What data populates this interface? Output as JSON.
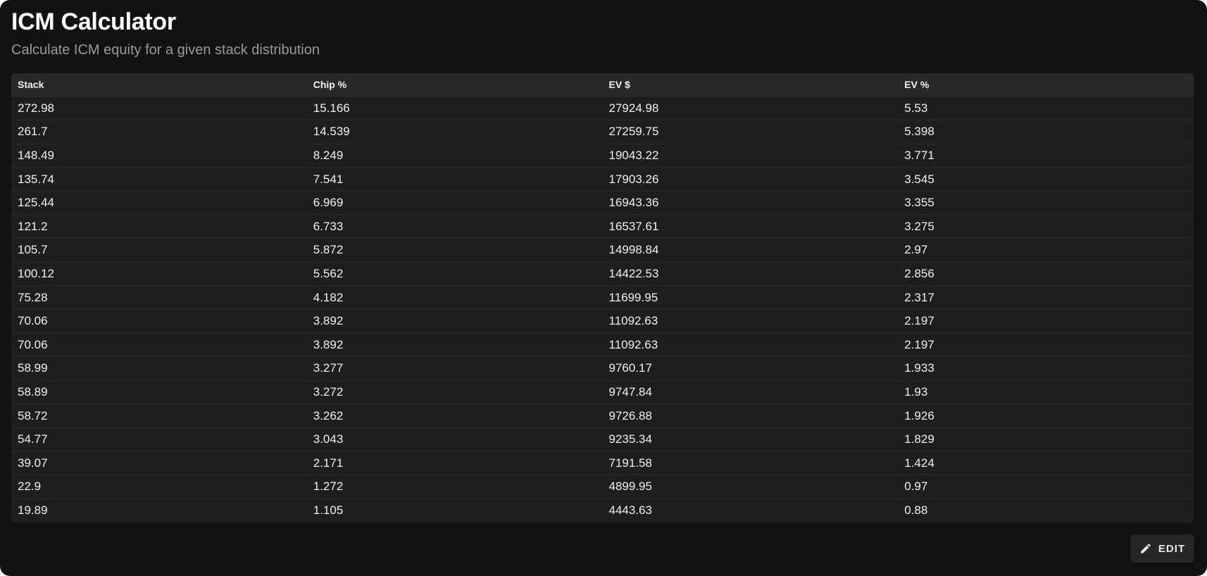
{
  "header": {
    "title": "ICM Calculator",
    "subtitle": "Calculate ICM equity for a given stack distribution"
  },
  "table": {
    "columns": [
      "Stack",
      "Chip %",
      "EV $",
      "EV %"
    ],
    "rows": [
      [
        "272.98",
        "15.166",
        "27924.98",
        "5.53"
      ],
      [
        "261.7",
        "14.539",
        "27259.75",
        "5.398"
      ],
      [
        "148.49",
        "8.249",
        "19043.22",
        "3.771"
      ],
      [
        "135.74",
        "7.541",
        "17903.26",
        "3.545"
      ],
      [
        "125.44",
        "6.969",
        "16943.36",
        "3.355"
      ],
      [
        "121.2",
        "6.733",
        "16537.61",
        "3.275"
      ],
      [
        "105.7",
        "5.872",
        "14998.84",
        "2.97"
      ],
      [
        "100.12",
        "5.562",
        "14422.53",
        "2.856"
      ],
      [
        "75.28",
        "4.182",
        "11699.95",
        "2.317"
      ],
      [
        "70.06",
        "3.892",
        "11092.63",
        "2.197"
      ],
      [
        "70.06",
        "3.892",
        "11092.63",
        "2.197"
      ],
      [
        "58.99",
        "3.277",
        "9760.17",
        "1.933"
      ],
      [
        "58.89",
        "3.272",
        "9747.84",
        "1.93"
      ],
      [
        "58.72",
        "3.262",
        "9726.88",
        "1.926"
      ],
      [
        "54.77",
        "3.043",
        "9235.34",
        "1.829"
      ],
      [
        "39.07",
        "2.171",
        "7191.58",
        "1.424"
      ],
      [
        "22.9",
        "1.272",
        "4899.95",
        "0.97"
      ],
      [
        "19.89",
        "1.105",
        "4443.63",
        "0.88"
      ]
    ]
  },
  "actions": {
    "edit_label": "EDIT",
    "edit_icon": "pencil-icon"
  },
  "colors": {
    "background": "#121212",
    "table_background": "#1e1e1e",
    "header_row": "#282828",
    "subtitle_text": "#9a9a9a"
  }
}
